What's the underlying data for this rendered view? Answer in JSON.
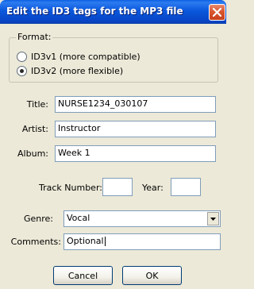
{
  "window": {
    "title": "Edit the ID3 tags for the MP3 file"
  },
  "format": {
    "legend": "Format:",
    "options": [
      {
        "label": "ID3v1 (more compatible)",
        "selected": false
      },
      {
        "label": "ID3v2 (more flexible)",
        "selected": true
      }
    ]
  },
  "fields": {
    "title": {
      "label": "Title:",
      "value": "NURSE1234_030107"
    },
    "artist": {
      "label": "Artist:",
      "value": "Instructor"
    },
    "album": {
      "label": "Album:",
      "value": "Week 1"
    },
    "track": {
      "label": "Track Number:",
      "value": ""
    },
    "year": {
      "label": "Year:",
      "value": ""
    },
    "genre": {
      "label": "Genre:",
      "value": "Vocal"
    },
    "comments": {
      "label": "Comments:",
      "value": "Optional"
    }
  },
  "buttons": {
    "cancel": "Cancel",
    "ok": "OK"
  },
  "icons": {
    "close": "close-icon",
    "dropdown": "chevron-down-icon"
  },
  "colors": {
    "titlebar": "#0A58DC",
    "dialog_bg": "#ECE9D8",
    "close_button": "#D9572F",
    "field_border": "#7F9DB9"
  }
}
